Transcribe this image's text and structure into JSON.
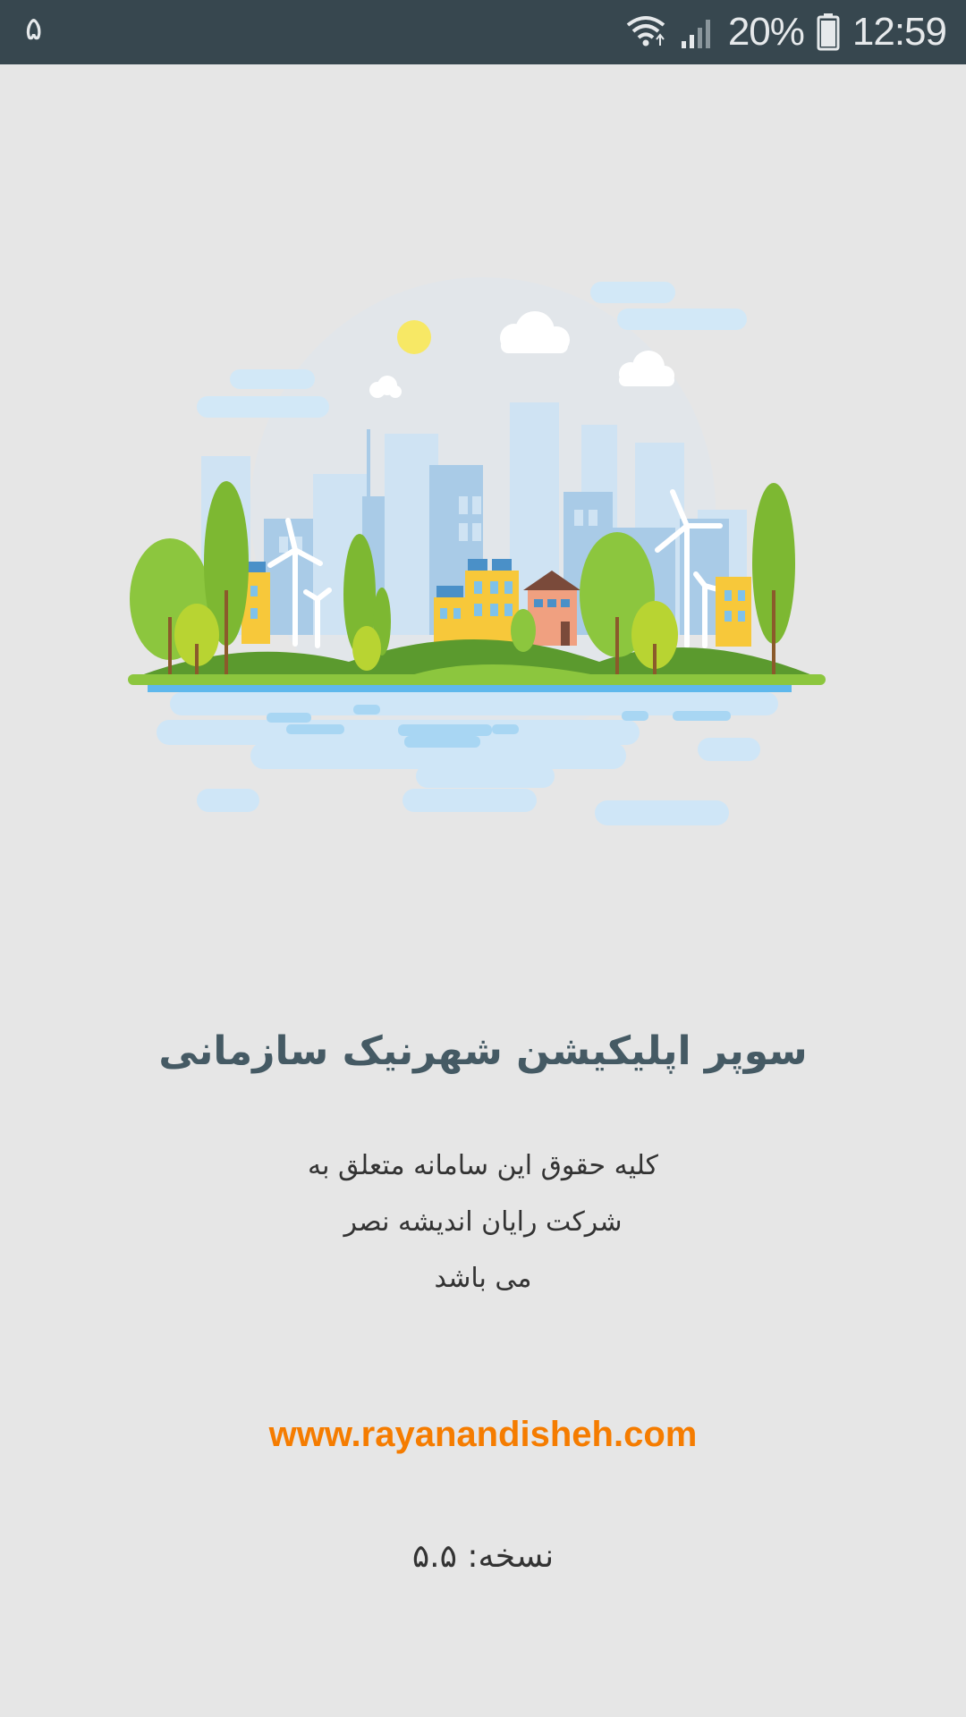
{
  "status_bar": {
    "notification_count": "۵",
    "battery_percent": "20%",
    "time": "12:59",
    "icons": [
      "wifi-icon",
      "signal-icon",
      "battery-icon"
    ],
    "background_color": "#37474f"
  },
  "splash": {
    "illustration": "city-landscape-illustration",
    "title": "سوپر اپلیکیشن شهرنیک سازمانی",
    "copyright_lines": [
      "کلیه حقوق این سامانه متعلق به",
      "شرکت رایان اندیشه نصر",
      "می باشد"
    ],
    "website": "www.rayanandisheh.com",
    "version": "نسخه: ۵.۵"
  },
  "colors": {
    "background": "#e6e6e6",
    "title": "#455a64",
    "link": "#f57c00"
  }
}
